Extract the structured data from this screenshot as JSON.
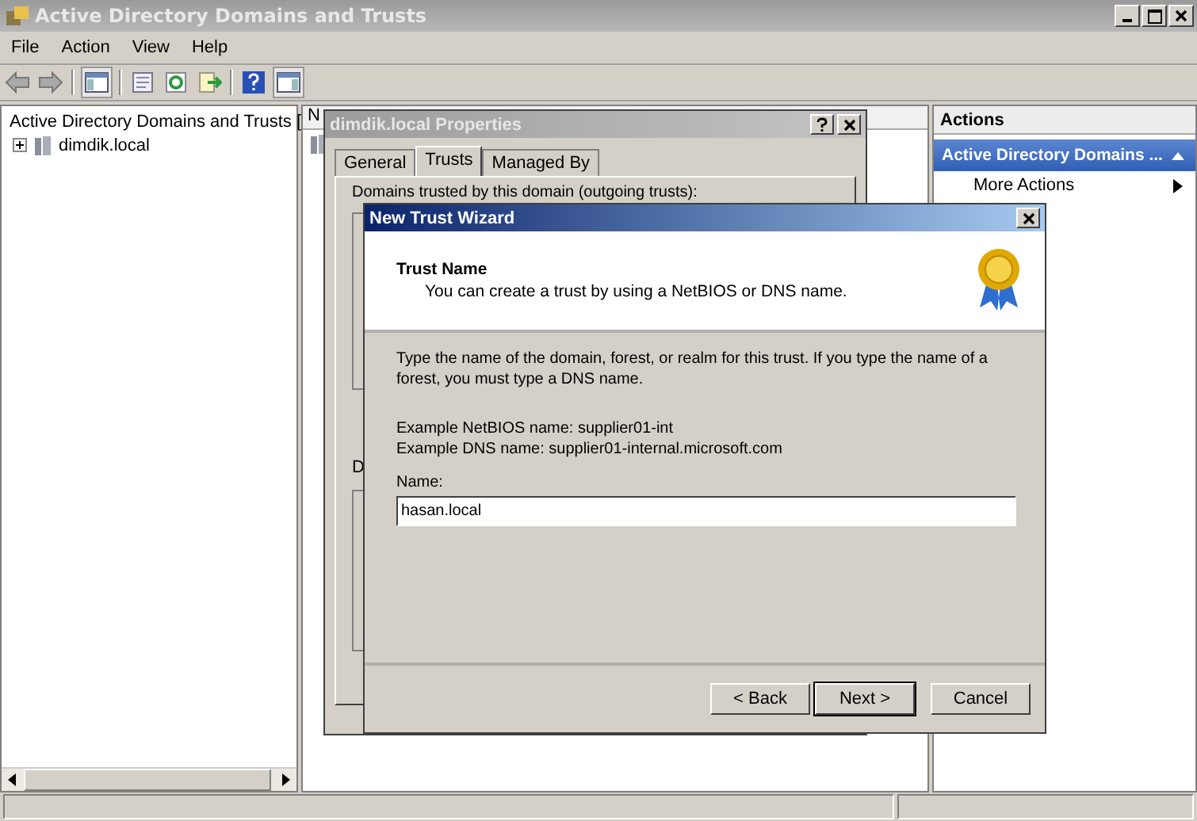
{
  "window": {
    "title": "Active Directory Domains and Trusts"
  },
  "menu": [
    "File",
    "Action",
    "View",
    "Help"
  ],
  "tree": [
    {
      "label": "Active Directory Domains and Trusts [",
      "children": [
        {
          "label": "dimdik.local",
          "expanded": false
        }
      ]
    }
  ],
  "list": {
    "column_1": "N"
  },
  "properties_dialog": {
    "title": "dimdik.local Properties",
    "tabs": [
      {
        "label": "General",
        "selected": false
      },
      {
        "label": "Trusts",
        "selected": true
      },
      {
        "label": "Managed By",
        "selected": false
      }
    ],
    "group_label": "Domains trusted by this domain (outgoing trusts):",
    "label_2": "D"
  },
  "wizard": {
    "title": "New Trust Wizard",
    "header_title": "Trust Name",
    "header_subtitle": "You can create a trust by using a NetBIOS or DNS name.",
    "description": "Type the name of the domain, forest, or realm for this trust. If you type the name of a forest, you must type a DNS name.",
    "examples": [
      "Example NetBIOS name: supplier01-int",
      "Example DNS name: supplier01-internal.microsoft.com"
    ],
    "name_label": "Name:",
    "name_value": "hasan.local",
    "buttons": [
      {
        "label": "< Back",
        "default": false
      },
      {
        "label": "Next >",
        "default": true
      },
      {
        "label": "Cancel",
        "default": false
      }
    ]
  },
  "actions": {
    "header": "Actions",
    "section": "Active Directory Domains ...",
    "items": [
      "More Actions"
    ]
  }
}
